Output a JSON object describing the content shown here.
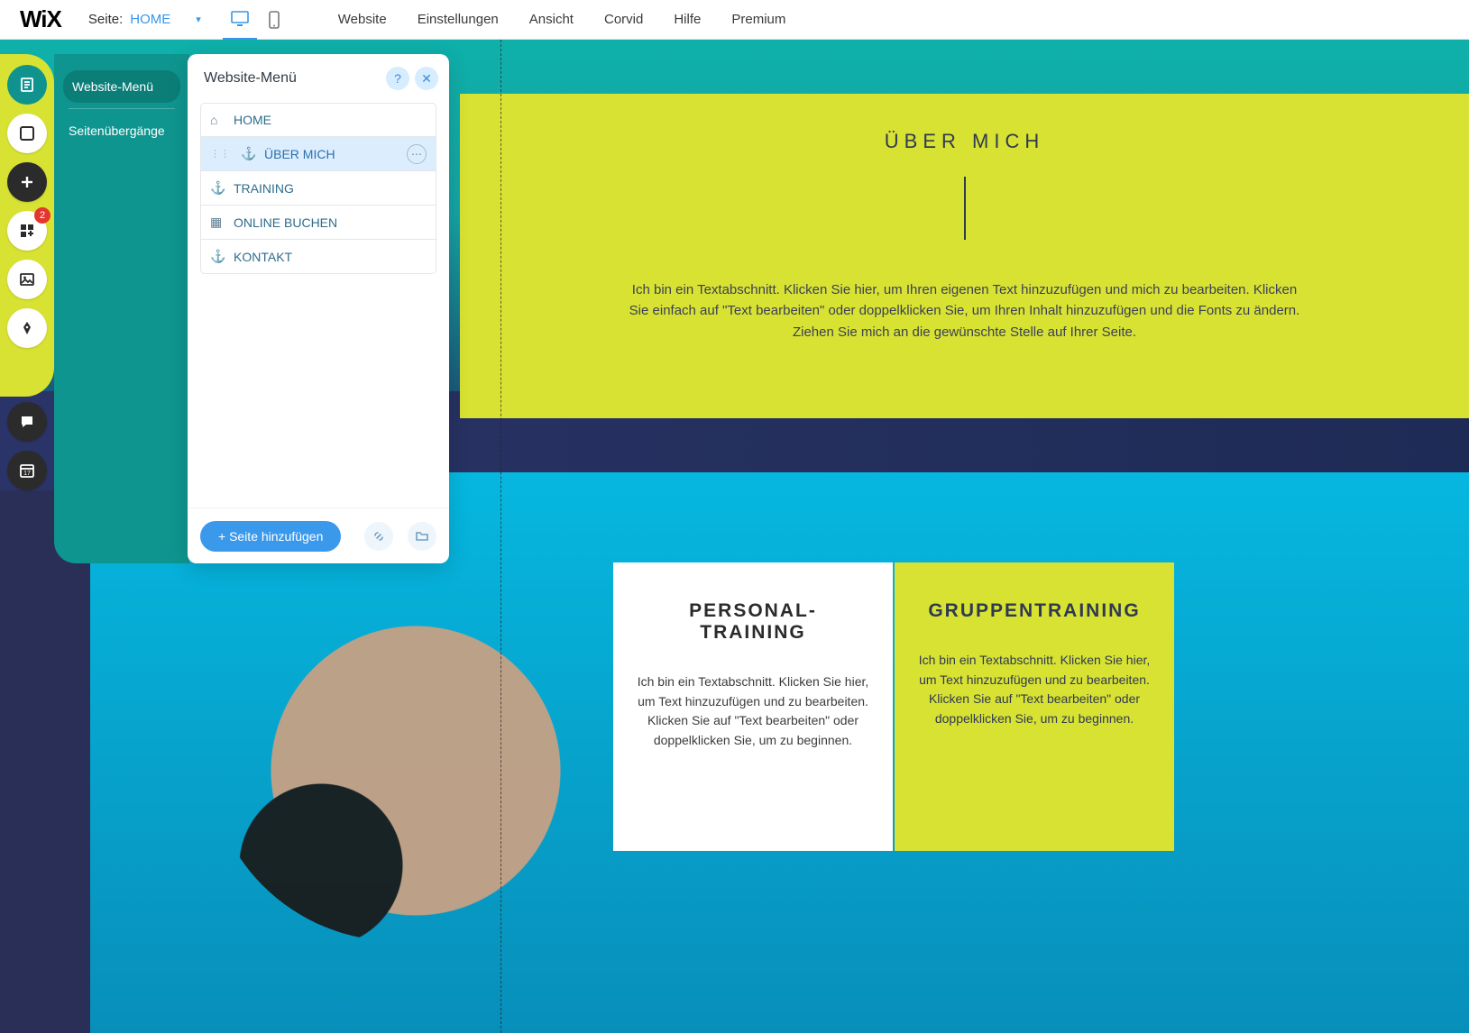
{
  "topbar": {
    "logo": "WiX",
    "page_label_static": "Seite:",
    "current_page": "HOME",
    "nav": [
      "Website",
      "Einstellungen",
      "Ansicht",
      "Corvid",
      "Hilfe",
      "Premium"
    ]
  },
  "tool_strip": {
    "apps_badge": "2"
  },
  "side_panel": {
    "items": [
      {
        "label": "Website-Menü",
        "active": true
      },
      {
        "label": "Seitenübergänge",
        "active": false
      }
    ]
  },
  "menu_popup": {
    "title": "Website-Menü",
    "pages": [
      {
        "name": "HOME",
        "icon": "home",
        "selected": false
      },
      {
        "name": "ÜBER MICH",
        "icon": "anchor",
        "selected": true
      },
      {
        "name": "TRAINING",
        "icon": "anchor",
        "selected": false
      },
      {
        "name": "ONLINE BUCHEN",
        "icon": "cal",
        "selected": false
      },
      {
        "name": "KONTAKT",
        "icon": "anchor",
        "selected": false
      }
    ],
    "add_page": "+ Seite hinzufügen"
  },
  "canvas": {
    "about": {
      "title": "ÜBER MICH",
      "text": "Ich bin ein Textabschnitt. Klicken Sie hier, um Ihren eigenen Text hinzuzufügen und mich zu bearbeiten. Klicken Sie einfach auf \"Text bearbeiten\" oder doppelklicken Sie, um Ihren Inhalt hinzuzufügen und die Fonts zu ändern. Ziehen Sie mich an die gewünschte Stelle auf Ihrer Seite."
    },
    "cards": {
      "pt": {
        "title": "PERSONAL-TRAINING",
        "text": "Ich bin ein Textabschnitt. Klicken Sie hier, um Text hinzuzufügen und zu bearbeiten. Klicken Sie auf \"Text bearbeiten\" oder doppelklicken Sie, um zu beginnen."
      },
      "gt": {
        "title": "GRUPPENTRAINING",
        "text": "Ich bin ein Textabschnitt. Klicken Sie hier, um Text hinzuzufügen und zu bearbeiten. Klicken Sie auf \"Text bearbeiten\" oder doppelklicken Sie, um zu beginnen."
      }
    }
  },
  "colors": {
    "accent_yellow": "#d8e233",
    "accent_teal": "#0f958f",
    "link_blue": "#3b99ec"
  }
}
